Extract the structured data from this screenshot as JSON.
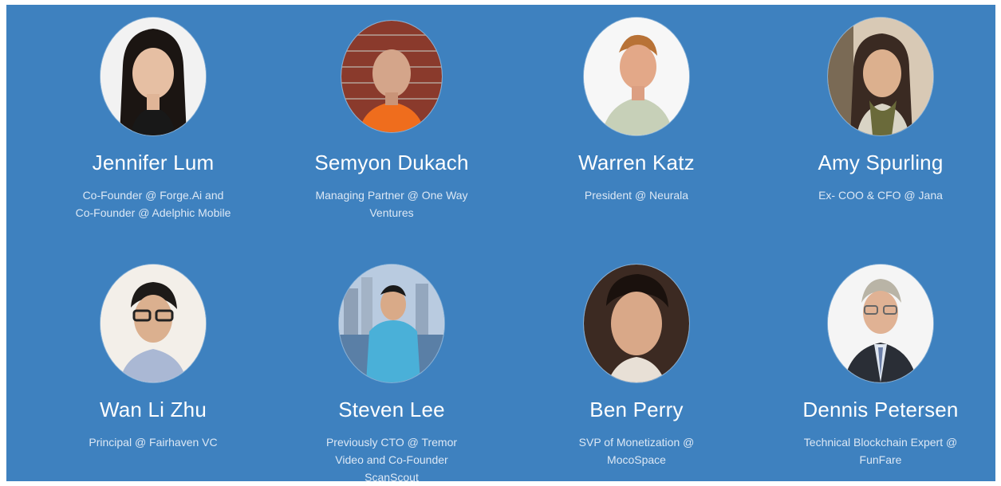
{
  "team": [
    {
      "name": "Jennifer Lum",
      "role": "Co-Founder @ Forge.Ai and Co-Founder @ Adelphic Mobile",
      "avatar_icon": "person-photo-icon"
    },
    {
      "name": "Semyon Dukach",
      "role": "Managing Partner @ One Way Ventures",
      "avatar_icon": "person-photo-icon"
    },
    {
      "name": "Warren Katz",
      "role": "President @ Neurala",
      "avatar_icon": "person-photo-icon"
    },
    {
      "name": "Amy Spurling",
      "role": "Ex- COO & CFO @ Jana",
      "avatar_icon": "person-photo-icon"
    },
    {
      "name": "Wan Li Zhu",
      "role": "Principal @ Fairhaven VC",
      "avatar_icon": "person-photo-icon"
    },
    {
      "name": "Steven Lee",
      "role": "Previously CTO @ Tremor Video and Co-Founder ScanScout",
      "avatar_icon": "person-photo-icon"
    },
    {
      "name": "Ben Perry",
      "role": "SVP of Monetization @ MocoSpace",
      "avatar_icon": "person-photo-icon"
    },
    {
      "name": "Dennis Petersen",
      "role": "Technical Blockchain Expert @ FunFare",
      "avatar_icon": "person-photo-icon"
    }
  ],
  "colors": {
    "background": "#3e81bf",
    "name_text": "#ffffff",
    "role_text": "#dce8f5"
  }
}
